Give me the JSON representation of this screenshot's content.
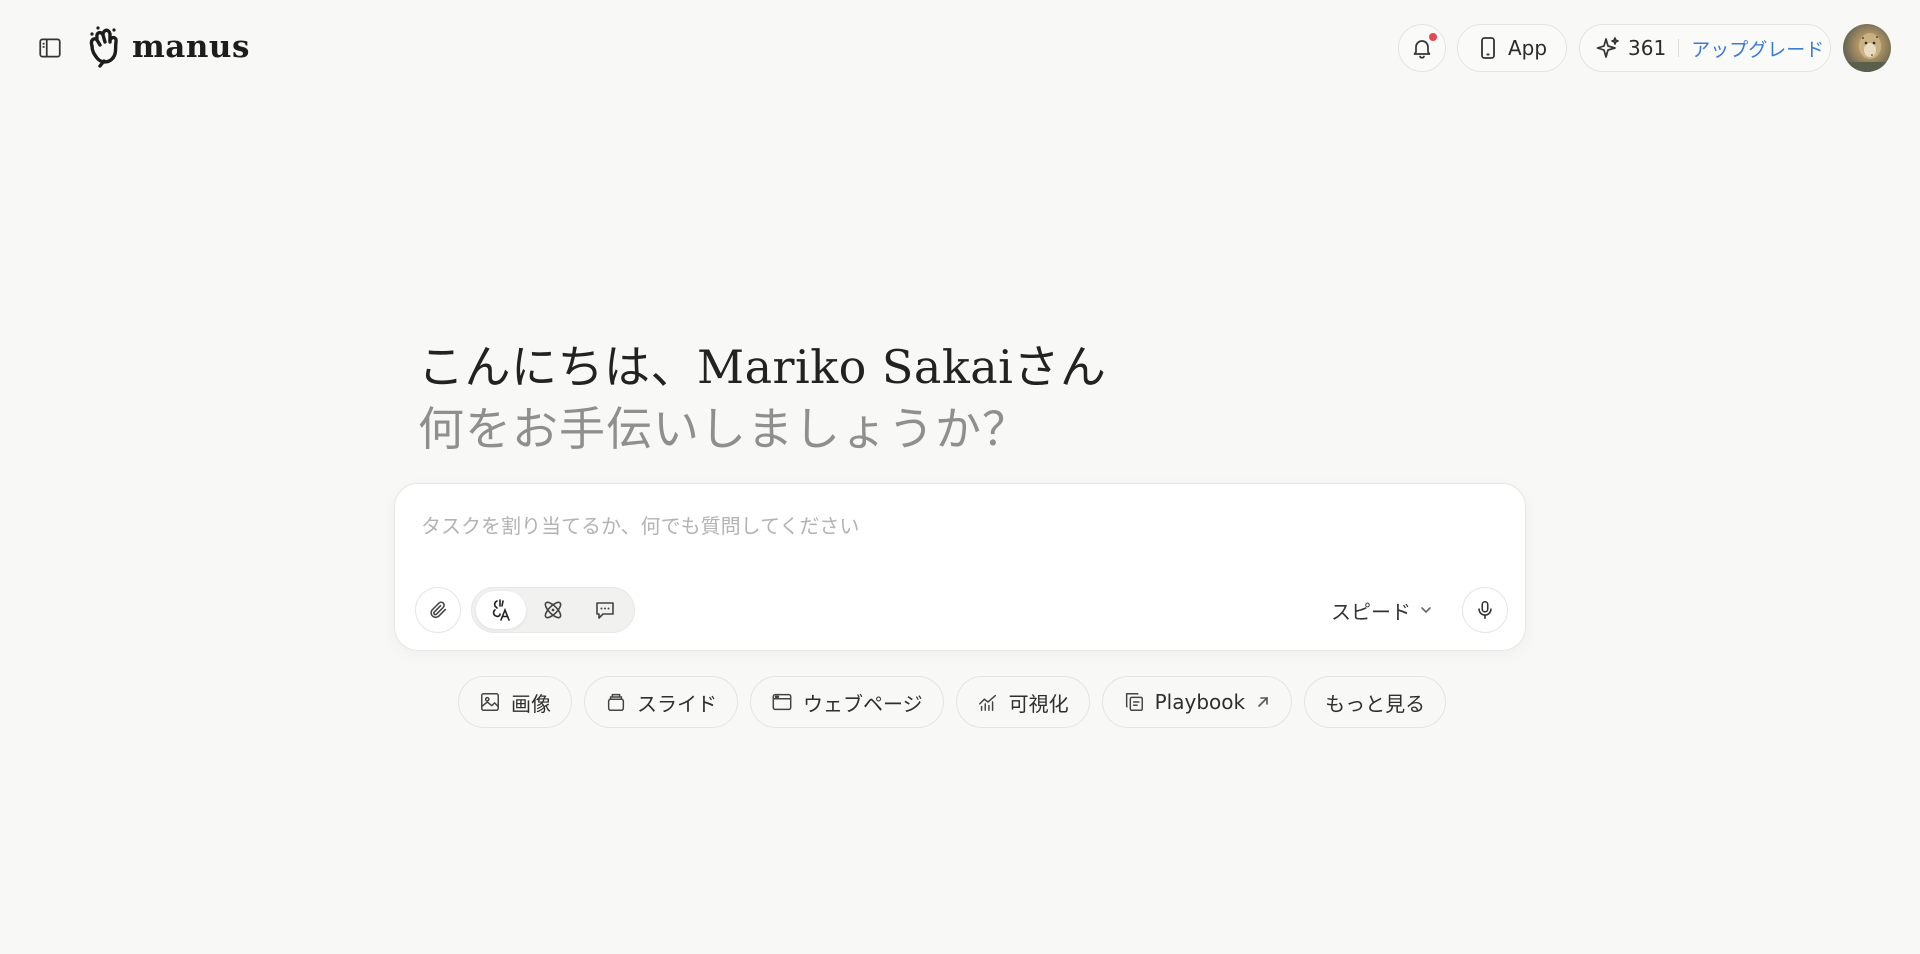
{
  "header": {
    "brand_name": "manus",
    "app_label": "App",
    "credits": "361",
    "upgrade_label": "アップグレード",
    "has_notification": true
  },
  "greeting": {
    "line1": "こんにちは、Mariko Sakaiさん",
    "line2": "何をお手伝いしましょうか？"
  },
  "composer": {
    "placeholder": "タスクを割り当てるか、何でも質問してください",
    "value": "",
    "speed_label": "スピード",
    "active_mode": "agent"
  },
  "suggestions": [
    {
      "label": "画像",
      "icon": "image-icon"
    },
    {
      "label": "スライド",
      "icon": "slides-icon"
    },
    {
      "label": "ウェブページ",
      "icon": "webpage-icon"
    },
    {
      "label": "可視化",
      "icon": "chart-icon"
    },
    {
      "label": "Playbook",
      "icon": "playbook-icon",
      "external": true
    },
    {
      "label": "もっと見る"
    }
  ],
  "colors": {
    "background": "#f8f8f7",
    "accent_link": "#3a7bd5",
    "notification_dot": "#e5484d"
  }
}
